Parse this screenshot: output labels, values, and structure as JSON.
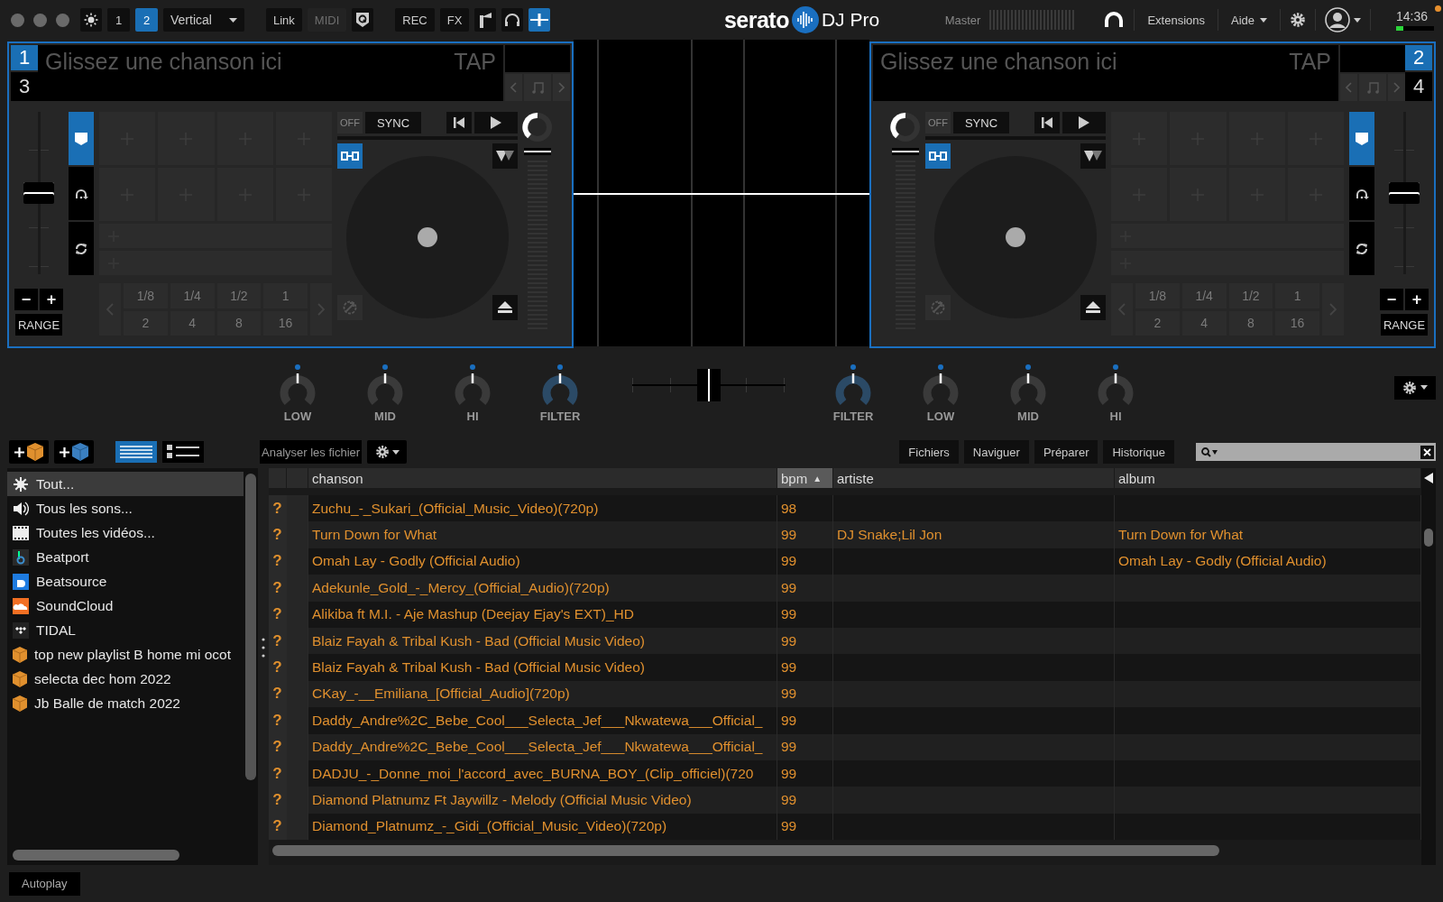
{
  "top_bar": {
    "deck_toggle": [
      {
        "label": "1",
        "selected": false
      },
      {
        "label": "2",
        "selected": true
      }
    ],
    "layout_dropdown": "Vertical",
    "link": "Link",
    "midi": {
      "label": "MIDI",
      "disabled": true
    },
    "rec": "REC",
    "fx": "FX",
    "brand": "serato",
    "product": "DJ Pro",
    "master_label": "Master",
    "extensions": "Extensions",
    "help": "Aide",
    "clock": "14:36"
  },
  "decks": [
    {
      "pitch": {
        "level": 0.5
      },
      "deck_number": "1",
      "alt_deck_number": "3",
      "display_placeholder": "Glissez une chanson ici",
      "tap": "TAP",
      "sync_off": "OFF",
      "sync": "SYNC",
      "range": "RANGE",
      "range_minus": "−",
      "range_plus": "+",
      "modes": [
        {
          "kind": "cue",
          "selected": true
        },
        {
          "kind": "roll",
          "selected": false
        },
        {
          "kind": "loop",
          "selected": false
        }
      ],
      "beat_jumps": [
        "1/8",
        "1/4",
        "1/2",
        "1",
        "2",
        "4",
        "8",
        "16"
      ]
    },
    {
      "pitch": {
        "level": 0.5
      },
      "deck_number": "2",
      "alt_deck_number": "4",
      "display_placeholder": "Glissez une chanson ici",
      "tap": "TAP",
      "sync_off": "OFF",
      "sync": "SYNC",
      "range": "RANGE",
      "range_minus": "−",
      "range_plus": "+",
      "modes": [
        {
          "kind": "cue",
          "selected": true
        },
        {
          "kind": "roll",
          "selected": false
        },
        {
          "kind": "loop",
          "selected": false
        }
      ],
      "beat_jumps": [
        "1/8",
        "1/4",
        "1/2",
        "1",
        "2",
        "4",
        "8",
        "16"
      ]
    }
  ],
  "mixer": {
    "left_knobs": [
      {
        "label": "LOW",
        "kind": "eq"
      },
      {
        "label": "MID",
        "kind": "eq"
      },
      {
        "label": "HI",
        "kind": "eq"
      },
      {
        "label": "FILTER",
        "kind": "filter"
      }
    ],
    "right_knobs": [
      {
        "label": "FILTER",
        "kind": "filter"
      },
      {
        "label": "LOW",
        "kind": "eq"
      },
      {
        "label": "MID",
        "kind": "eq"
      },
      {
        "label": "HI",
        "kind": "eq"
      }
    ]
  },
  "browser": {
    "views": [
      {
        "kind": "list",
        "selected": true
      },
      {
        "kind": "detail",
        "selected": false
      }
    ],
    "analyze": "Analyser les fichier",
    "tabs": [
      {
        "label": "Fichiers",
        "selected": false
      },
      {
        "label": "Naviguer",
        "selected": false
      },
      {
        "label": "Préparer",
        "selected": false
      },
      {
        "label": "Historique",
        "selected": false
      }
    ]
  },
  "sidebar": {
    "items": [
      {
        "kind": "all",
        "label": "Tout...",
        "selected": true
      },
      {
        "kind": "audio",
        "label": "Tous les sons...",
        "selected": false
      },
      {
        "kind": "video",
        "label": "Toutes les vidéos...",
        "selected": false
      },
      {
        "kind": "beatport",
        "label": "Beatport",
        "selected": false
      },
      {
        "kind": "beatsource",
        "label": "Beatsource",
        "selected": false
      },
      {
        "kind": "soundcloud",
        "label": "SoundCloud",
        "selected": false
      },
      {
        "kind": "tidal",
        "label": "TIDAL",
        "selected": false
      },
      {
        "kind": "crate",
        "label": "top new playlist B home mi ocot",
        "selected": false
      },
      {
        "kind": "crate",
        "label": "selecta dec hom 2022",
        "selected": false
      },
      {
        "kind": "crate",
        "label": "Jb Balle de match 2022",
        "selected": false
      }
    ]
  },
  "table": {
    "columns": [
      {
        "label": "chanson",
        "sorted": false
      },
      {
        "label": "bpm",
        "sorted": true,
        "sort_indicator": "▲"
      },
      {
        "label": "artiste",
        "sorted": false
      },
      {
        "label": "album",
        "sorted": false
      }
    ],
    "rows": [
      {
        "status": "?",
        "song": "Zuchu_-_Sukari_(Official_Music_Video)(720p)",
        "bpm": "98"
      },
      {
        "status": "?",
        "song": "Turn Down for What",
        "bpm": "99",
        "artist": "DJ Snake;Lil Jon",
        "album": "Turn Down for What"
      },
      {
        "status": "?",
        "song": "Omah Lay - Godly (Official Audio)",
        "bpm": "99",
        "album": "Omah Lay - Godly (Official Audio)"
      },
      {
        "status": "?",
        "song": "Adekunle_Gold_-_Mercy_(Official_Audio)(720p)",
        "bpm": "99"
      },
      {
        "status": "?",
        "song": "Alikiba ft M.I. - Aje Mashup (Deejay Ejay's EXT)_HD",
        "bpm": "99"
      },
      {
        "status": "?",
        "song": "Blaiz Fayah & Tribal Kush - Bad (Official Music Video)",
        "bpm": "99"
      },
      {
        "status": "?",
        "song": "Blaiz Fayah & Tribal Kush - Bad (Official Music Video)",
        "bpm": "99"
      },
      {
        "status": "?",
        "song": "CKay_-__Emiliana_[Official_Audio](720p)",
        "bpm": "99"
      },
      {
        "status": "?",
        "song": "Daddy_Andre%2C_Bebe_Cool___Selecta_Jef___Nkwatewa___Official_",
        "bpm": "99"
      },
      {
        "status": "?",
        "song": "Daddy_Andre%2C_Bebe_Cool___Selecta_Jef___Nkwatewa___Official_",
        "bpm": "99"
      },
      {
        "status": "?",
        "song": "DADJU_-_Donne_moi_l'accord_avec_BURNA_BOY_(Clip_officiel)(720",
        "bpm": "99"
      },
      {
        "status": "?",
        "song": "Diamond Platnumz Ft Jaywillz - Melody (Official Music Video)",
        "bpm": "99"
      },
      {
        "status": "?",
        "song": "Diamond_Platnumz_-_Gidi_(Official_Music_Video)(720p)",
        "bpm": "99"
      }
    ]
  },
  "autoplay": "Autoplay"
}
